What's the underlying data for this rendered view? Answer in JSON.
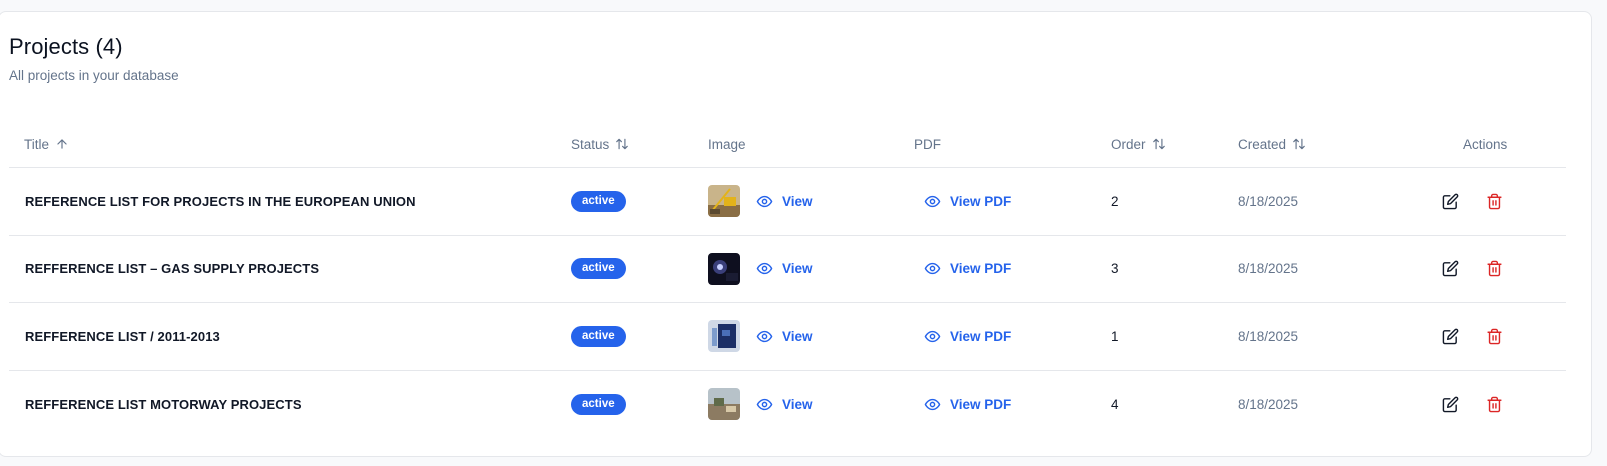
{
  "header": {
    "title": "Projects (4)",
    "subtitle": "All projects in your database"
  },
  "columns": {
    "title": "Title",
    "status": "Status",
    "image": "Image",
    "pdf": "PDF",
    "order": "Order",
    "created": "Created",
    "actions": "Actions"
  },
  "rows": [
    {
      "title": "REFERENCE LIST FOR PROJECTS IN THE EUROPEAN UNION",
      "status": "active",
      "image_link": "View",
      "pdf_link": "View PDF",
      "order": "2",
      "created": "8/18/2025",
      "thumb": "construction-crane"
    },
    {
      "title": "REFFERENCE LIST – GAS SUPPLY PROJECTS",
      "status": "active",
      "image_link": "View",
      "pdf_link": "View PDF",
      "order": "3",
      "created": "8/18/2025",
      "thumb": "dark-pipe"
    },
    {
      "title": "REFFERENCE LIST / 2011-2013",
      "status": "active",
      "image_link": "View",
      "pdf_link": "View PDF",
      "order": "1",
      "created": "8/18/2025",
      "thumb": "blue-machine"
    },
    {
      "title": "REFFERENCE LIST MOTORWAY PROJECTS",
      "status": "active",
      "image_link": "View",
      "pdf_link": "View PDF",
      "order": "4",
      "created": "8/18/2025",
      "thumb": "road-works"
    }
  ],
  "colors": {
    "accent": "#2563eb",
    "danger": "#dc2626",
    "muted": "#64748b"
  }
}
